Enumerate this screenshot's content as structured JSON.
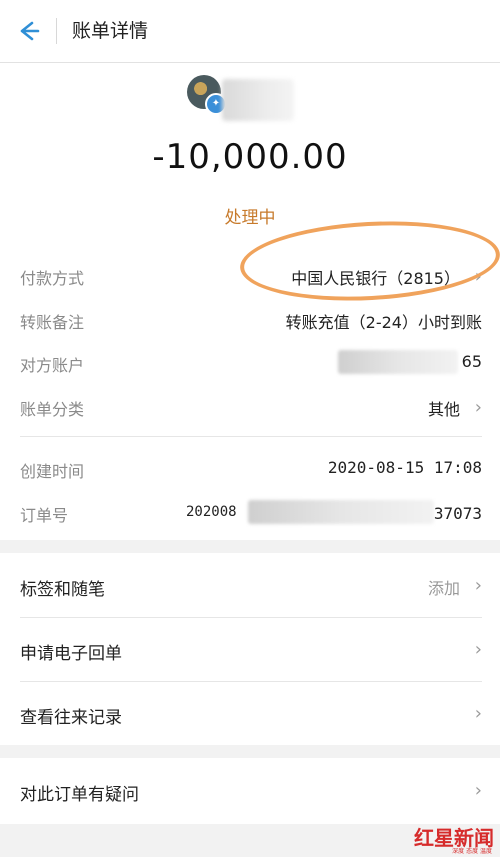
{
  "header": {
    "title": "账单详情",
    "back_icon": "arrow-left-icon",
    "accent": "#2f8fd6"
  },
  "summary": {
    "amount": "-10,000.00",
    "status": "处理中",
    "status_color": "#c77a2b"
  },
  "details": [
    {
      "key": "payment_method",
      "label": "付款方式",
      "value": "中国人民银行（2815）",
      "chevron": true
    },
    {
      "key": "transfer_note",
      "label": "转账备注",
      "value": "转账充值（2-24）小时到账",
      "chevron": false
    },
    {
      "key": "counterparty",
      "label": "对方账户",
      "value": "65",
      "chevron": false
    },
    {
      "key": "category",
      "label": "账单分类",
      "value": "其他",
      "chevron": true
    },
    {
      "key": "created",
      "label": "创建时间",
      "value": "2020-08-15 17:08",
      "chevron": false
    },
    {
      "key": "order_no",
      "label": "订单号",
      "value_prefix": "202008",
      "value_suffix": "37073",
      "chevron": false
    }
  ],
  "actions": [
    {
      "key": "tags",
      "label": "标签和随笔",
      "right": "添加"
    },
    {
      "key": "e_receipt",
      "label": "申请电子回单",
      "right": ""
    },
    {
      "key": "history",
      "label": "查看往来记录",
      "right": ""
    }
  ],
  "question": {
    "label": "对此订单有疑问"
  },
  "watermark": {
    "text": "红星新闻",
    "sub": "深度 态度 温度"
  }
}
